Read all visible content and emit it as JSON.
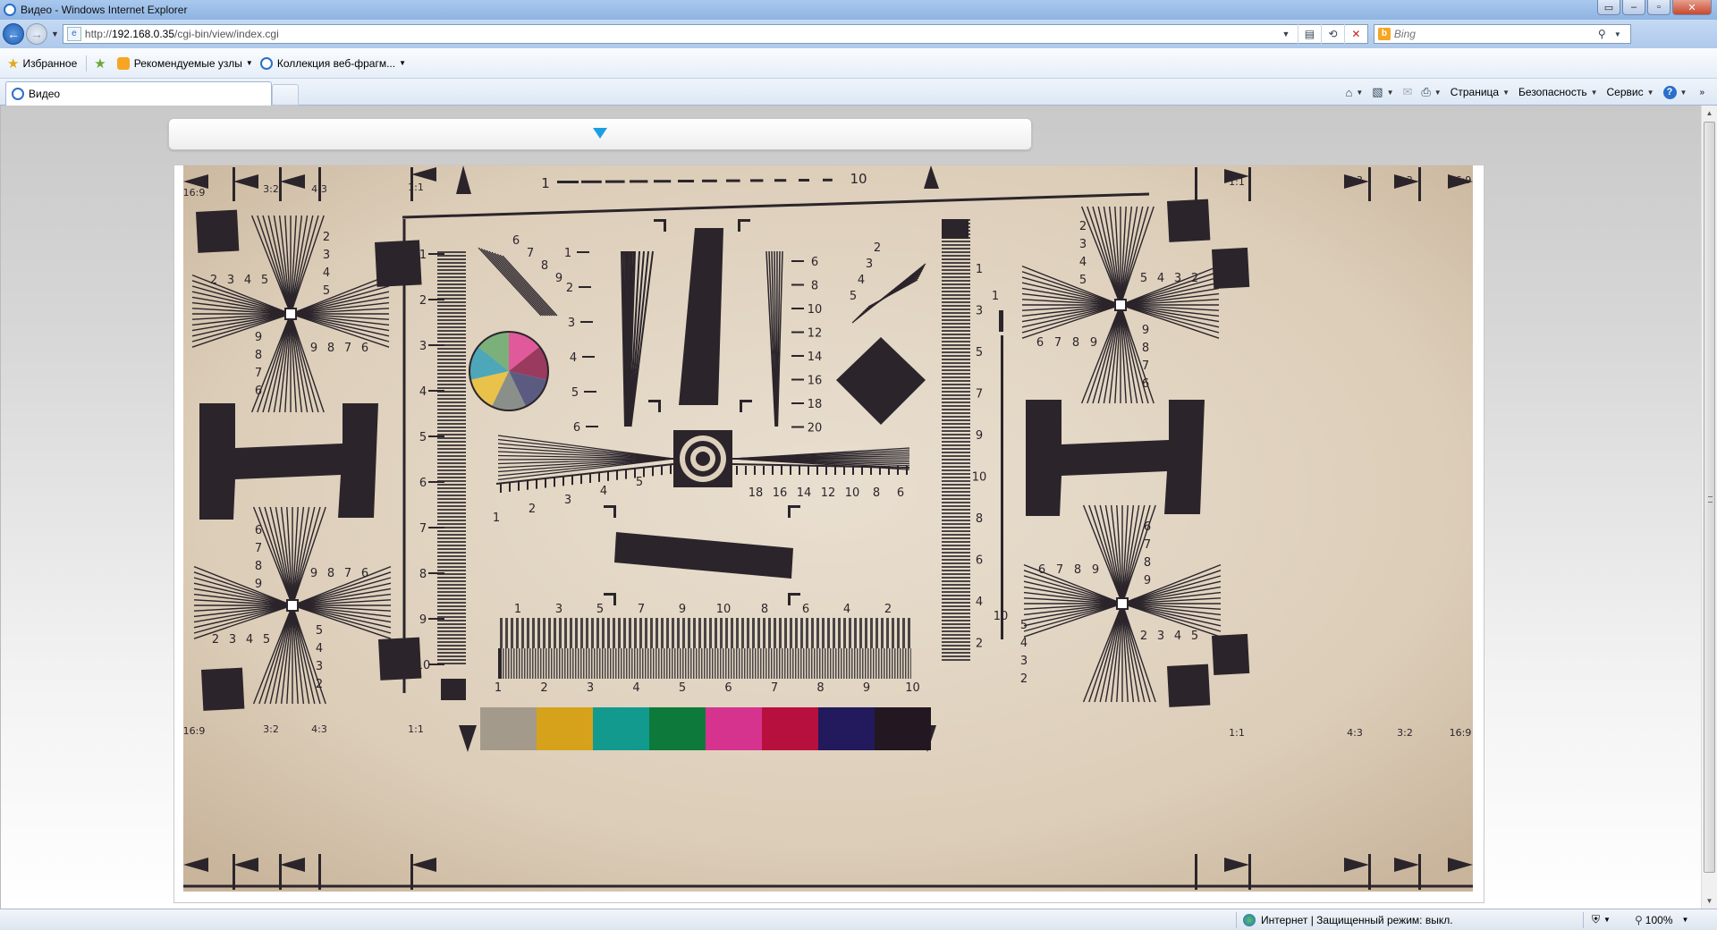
{
  "window": {
    "title": "Видео - Windows Internet Explorer"
  },
  "address": {
    "url_prefix": "http://",
    "url_host": "192.168.0.35",
    "url_path": "/cgi-bin/view/index.cgi"
  },
  "search": {
    "placeholder": "Bing"
  },
  "favorites_bar": {
    "favorites_label": "Избранное",
    "items": [
      {
        "label": "Рекомендуемые узлы"
      },
      {
        "label": "Коллекция веб-фрагм..."
      }
    ]
  },
  "tab": {
    "label": "Видео"
  },
  "command_bar": {
    "page_label": "Страница",
    "safety_label": "Безопасность",
    "tools_label": "Сервис",
    "help_glyph": "?"
  },
  "status": {
    "zone_text": "Интернет | Защищенный режим: выкл.",
    "zoom": "100%"
  },
  "video": {
    "content": "test chart",
    "aspect_labels": [
      "16:9",
      "3:2",
      "4:3",
      "1:1"
    ],
    "color_bars": [
      "#a49a8c",
      "#d6a21c",
      "#129a8e",
      "#0d7a3c",
      "#d6338e",
      "#b8103e",
      "#221a5c",
      "#231722"
    ],
    "wheel_colors": [
      "#e05a9b",
      "#9a3a5e",
      "#5b5b82",
      "#8a8f8a",
      "#e8c24a",
      "#4da7b8",
      "#7bb07a"
    ],
    "numbers": {
      "top_scale": [
        "1",
        "10"
      ],
      "left_scale": [
        "1",
        "2",
        "3",
        "4",
        "5",
        "6",
        "7",
        "8",
        "9",
        "10"
      ],
      "right_scale": [
        "1",
        "3",
        "5",
        "7",
        "9",
        "10",
        "8",
        "6",
        "4",
        "2"
      ],
      "ext_right": [
        "1",
        "10"
      ],
      "bottom_top": [
        "1",
        "3",
        "5",
        "7",
        "9",
        "10",
        "8",
        "6",
        "4",
        "2"
      ],
      "bottom_bot": [
        "1",
        "2",
        "3",
        "4",
        "5",
        "6",
        "7",
        "8",
        "9",
        "10"
      ],
      "wedge_left": [
        "1",
        "2",
        "3",
        "4",
        "5",
        "6"
      ],
      "wedge_right": [
        "6",
        "8",
        "10",
        "12",
        "14",
        "16",
        "18",
        "20"
      ],
      "horiz_left": [
        "1",
        "2",
        "3",
        "4",
        "5"
      ],
      "horiz_right": [
        "18",
        "16",
        "14",
        "12",
        "10",
        "8",
        "6"
      ],
      "fan_tl": [
        "6",
        "7",
        "8",
        "9"
      ],
      "fan_tr": [
        "2",
        "3",
        "4",
        "5"
      ],
      "star_a": [
        "2",
        "3",
        "4",
        "5"
      ],
      "star_b": [
        "9",
        "8",
        "7",
        "6"
      ],
      "star_c": [
        "6",
        "7",
        "8",
        "9"
      ],
      "star_d": [
        "5",
        "4",
        "3",
        "2"
      ]
    }
  }
}
